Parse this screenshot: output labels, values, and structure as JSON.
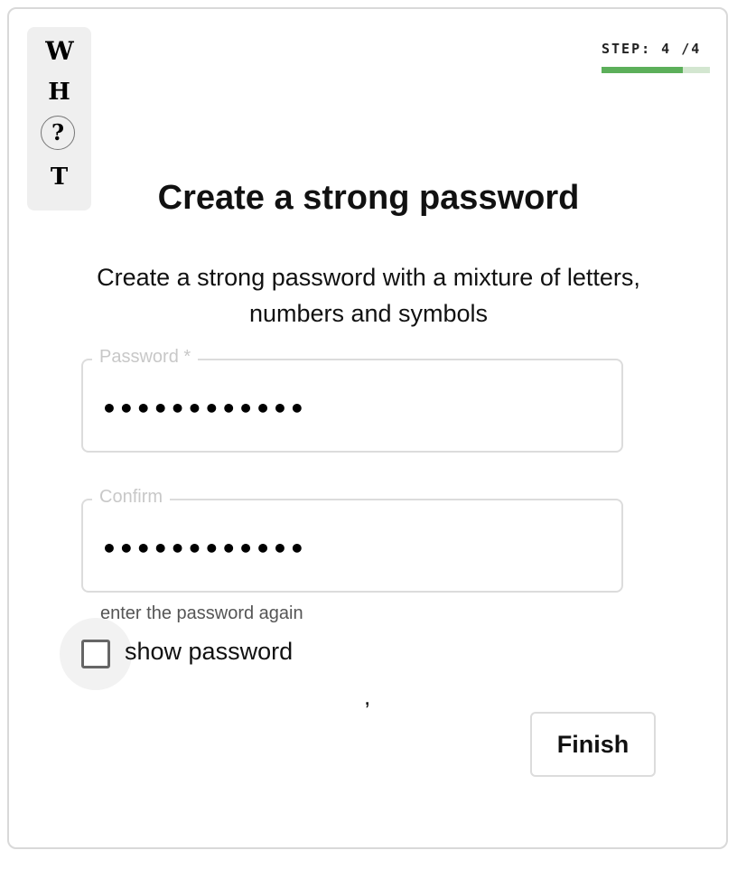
{
  "logo": {
    "letters": [
      "W",
      "H",
      "?",
      "T"
    ]
  },
  "stepper": {
    "label": "STEP: 4 /4",
    "progress_fraction": 0.75,
    "fill_color": "#5caf5a",
    "track_color": "#d3e6d0"
  },
  "header": {
    "title": "Create a strong password",
    "subtitle": "Create a strong password with a mixture of letters, numbers and symbols"
  },
  "form": {
    "password": {
      "label": "Password *",
      "value": "••••••••••••"
    },
    "confirm": {
      "label": "Confirm",
      "value": "••••••••••••",
      "helper": "enter the password again"
    },
    "show_password": {
      "label": "show password",
      "checked": false
    },
    "stray_text": ",",
    "finish_label": "Finish"
  }
}
